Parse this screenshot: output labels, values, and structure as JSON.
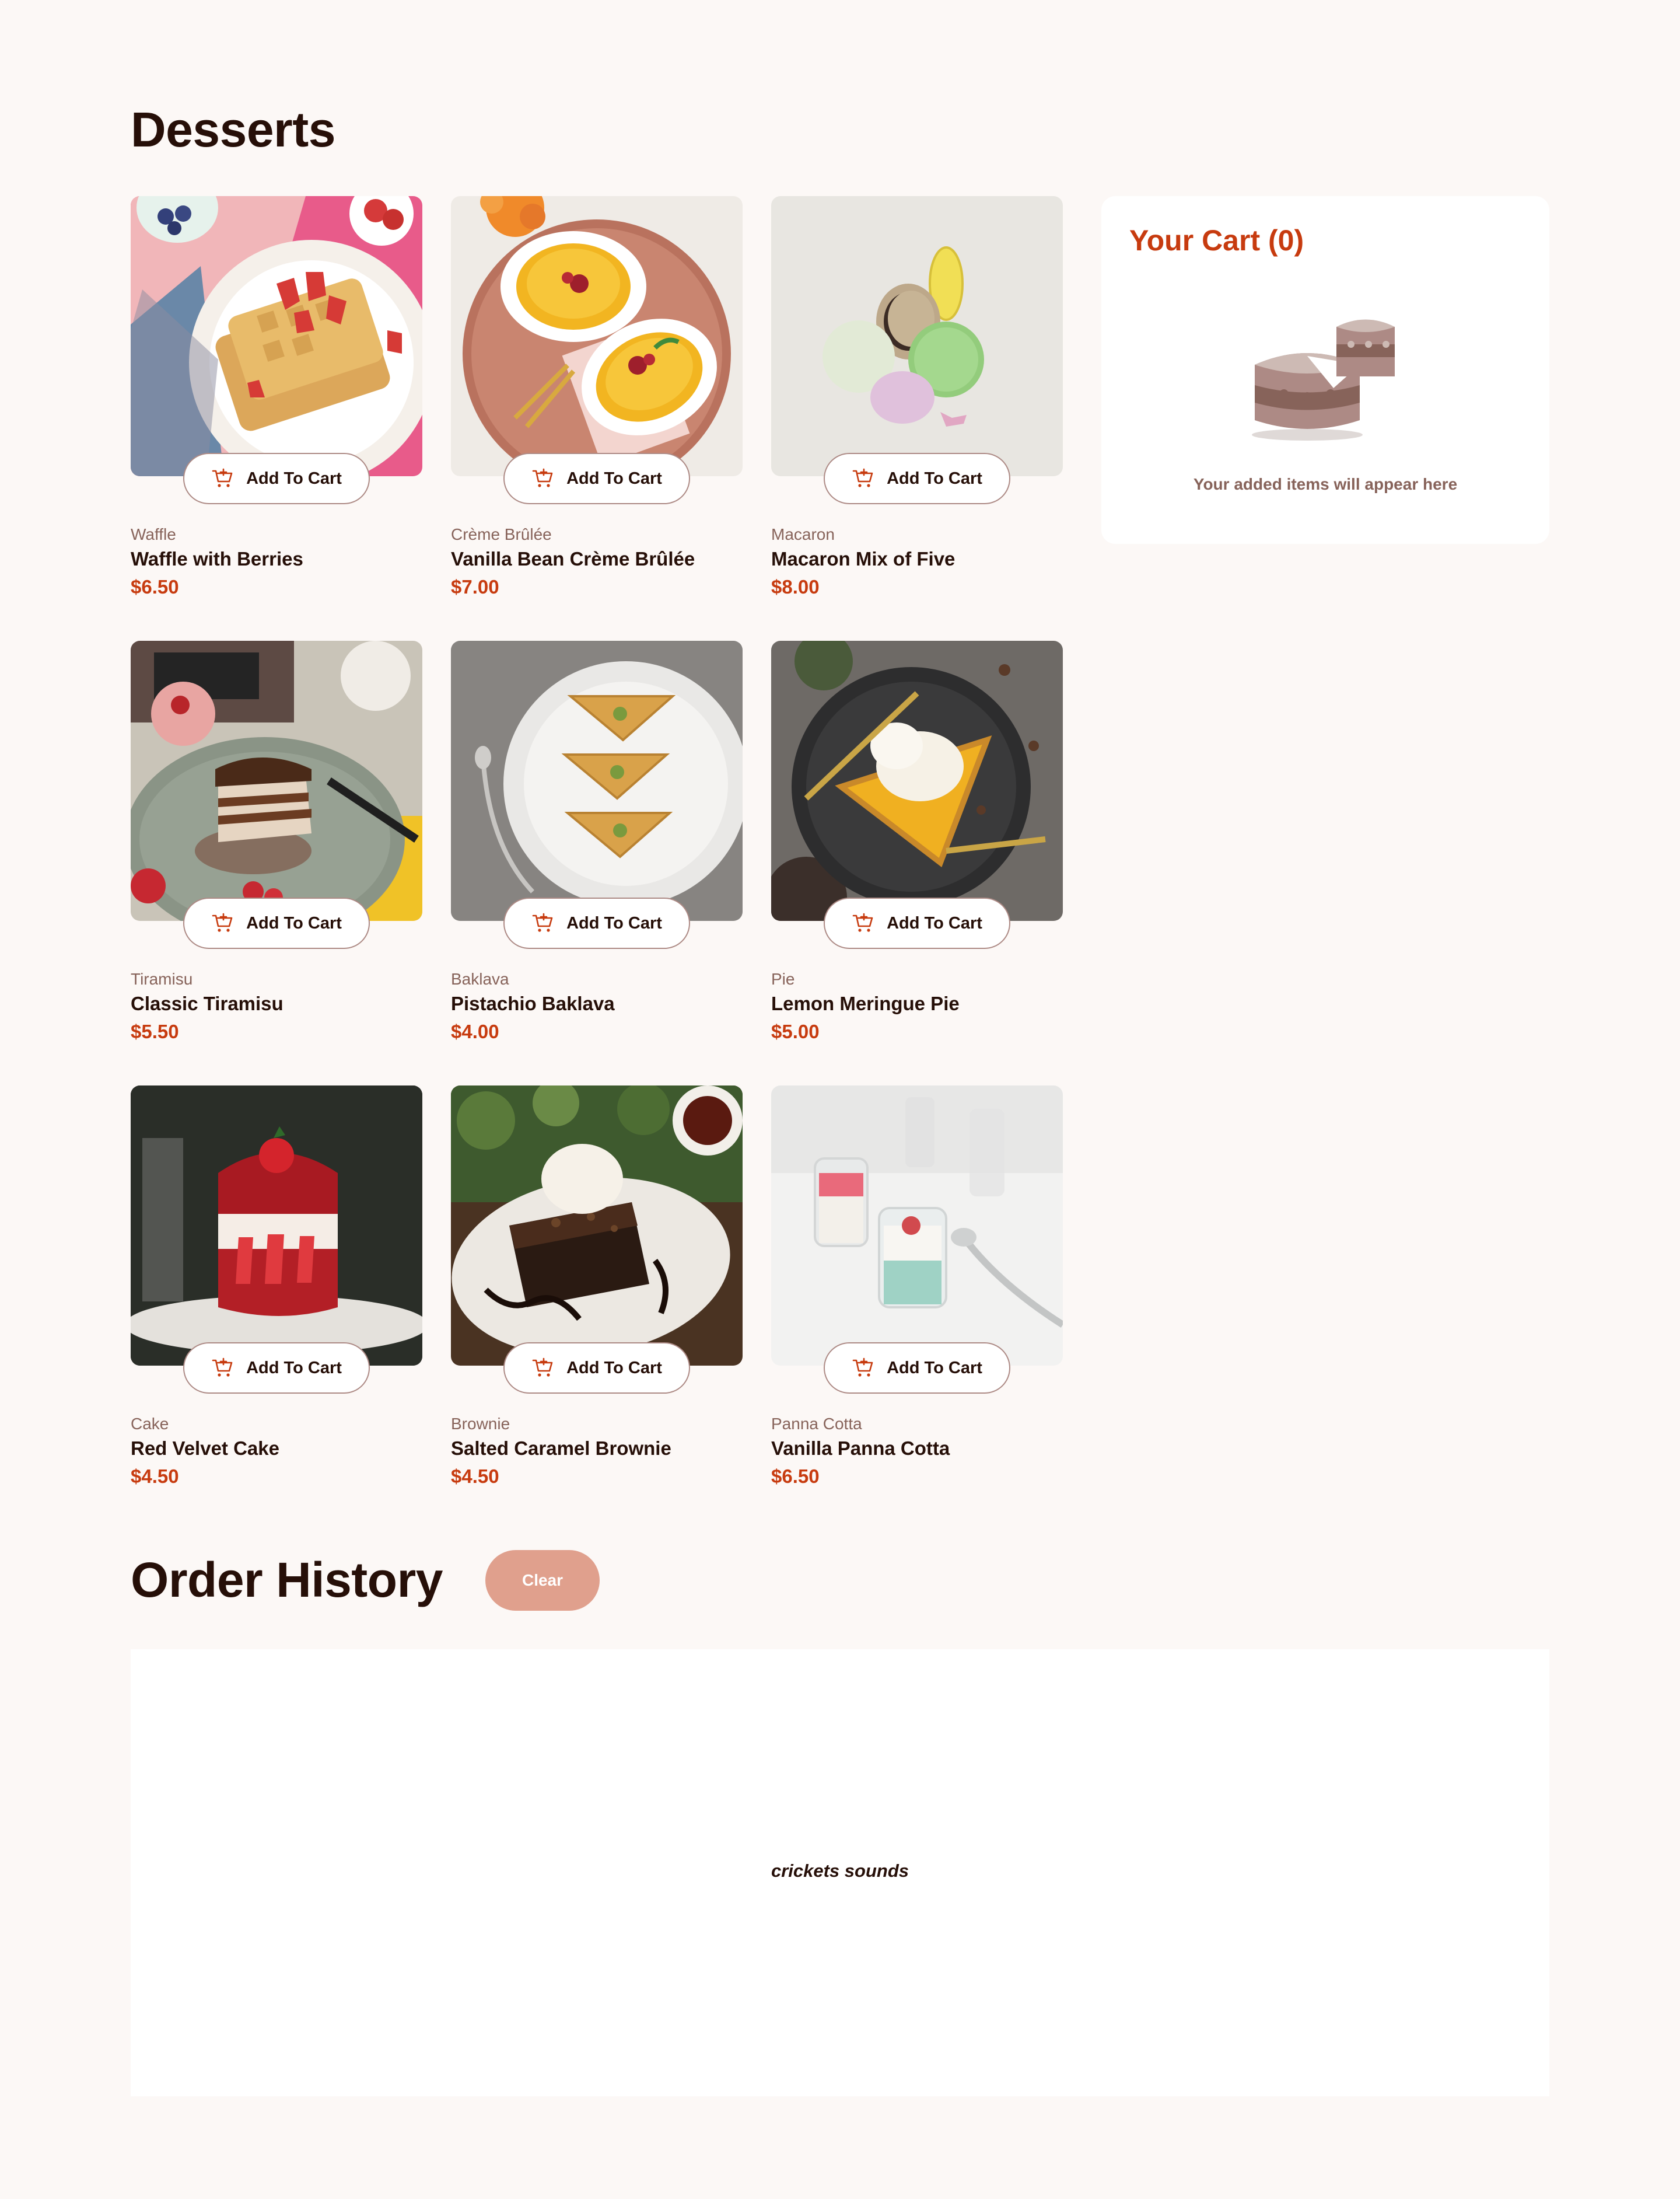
{
  "page": {
    "title": "Desserts"
  },
  "products": [
    {
      "category": "Waffle",
      "name": "Waffle with Berries",
      "price": "$6.50",
      "image": "waffle-photo",
      "button_label": "Add To Cart"
    },
    {
      "category": "Crème Brûlée",
      "name": "Vanilla Bean Crème Brûlée",
      "price": "$7.00",
      "image": "creme-brulee-photo",
      "button_label": "Add To Cart"
    },
    {
      "category": "Macaron",
      "name": "Macaron Mix of Five",
      "price": "$8.00",
      "image": "macaron-photo",
      "button_label": "Add To Cart"
    },
    {
      "category": "Tiramisu",
      "name": "Classic Tiramisu",
      "price": "$5.50",
      "image": "tiramisu-photo",
      "button_label": "Add To Cart"
    },
    {
      "category": "Baklava",
      "name": "Pistachio Baklava",
      "price": "$4.00",
      "image": "baklava-photo",
      "button_label": "Add To Cart"
    },
    {
      "category": "Pie",
      "name": "Lemon Meringue Pie",
      "price": "$5.00",
      "image": "pie-photo",
      "button_label": "Add To Cart"
    },
    {
      "category": "Cake",
      "name": "Red Velvet Cake",
      "price": "$4.50",
      "image": "cake-photo",
      "button_label": "Add To Cart"
    },
    {
      "category": "Brownie",
      "name": "Salted Caramel Brownie",
      "price": "$4.50",
      "image": "brownie-photo",
      "button_label": "Add To Cart"
    },
    {
      "category": "Panna Cotta",
      "name": "Vanilla Panna Cotta",
      "price": "$6.50",
      "image": "panna-cotta-photo",
      "button_label": "Add To Cart"
    }
  ],
  "cart": {
    "title": "Your Cart (0)",
    "empty_message": "Your added items will appear here",
    "illustration": "empty-cart-cake-illustration"
  },
  "order_history": {
    "title": "Order History",
    "clear_label": "Clear",
    "empty_message": "crickets sounds"
  },
  "colors": {
    "background": "#fcf8f6",
    "accent_red": "#c73b0f",
    "text_dark": "#260f08",
    "text_muted": "#87635a",
    "clear_button": "#e0a08d"
  },
  "icons": {
    "add_to_cart": "cart-plus-icon"
  }
}
